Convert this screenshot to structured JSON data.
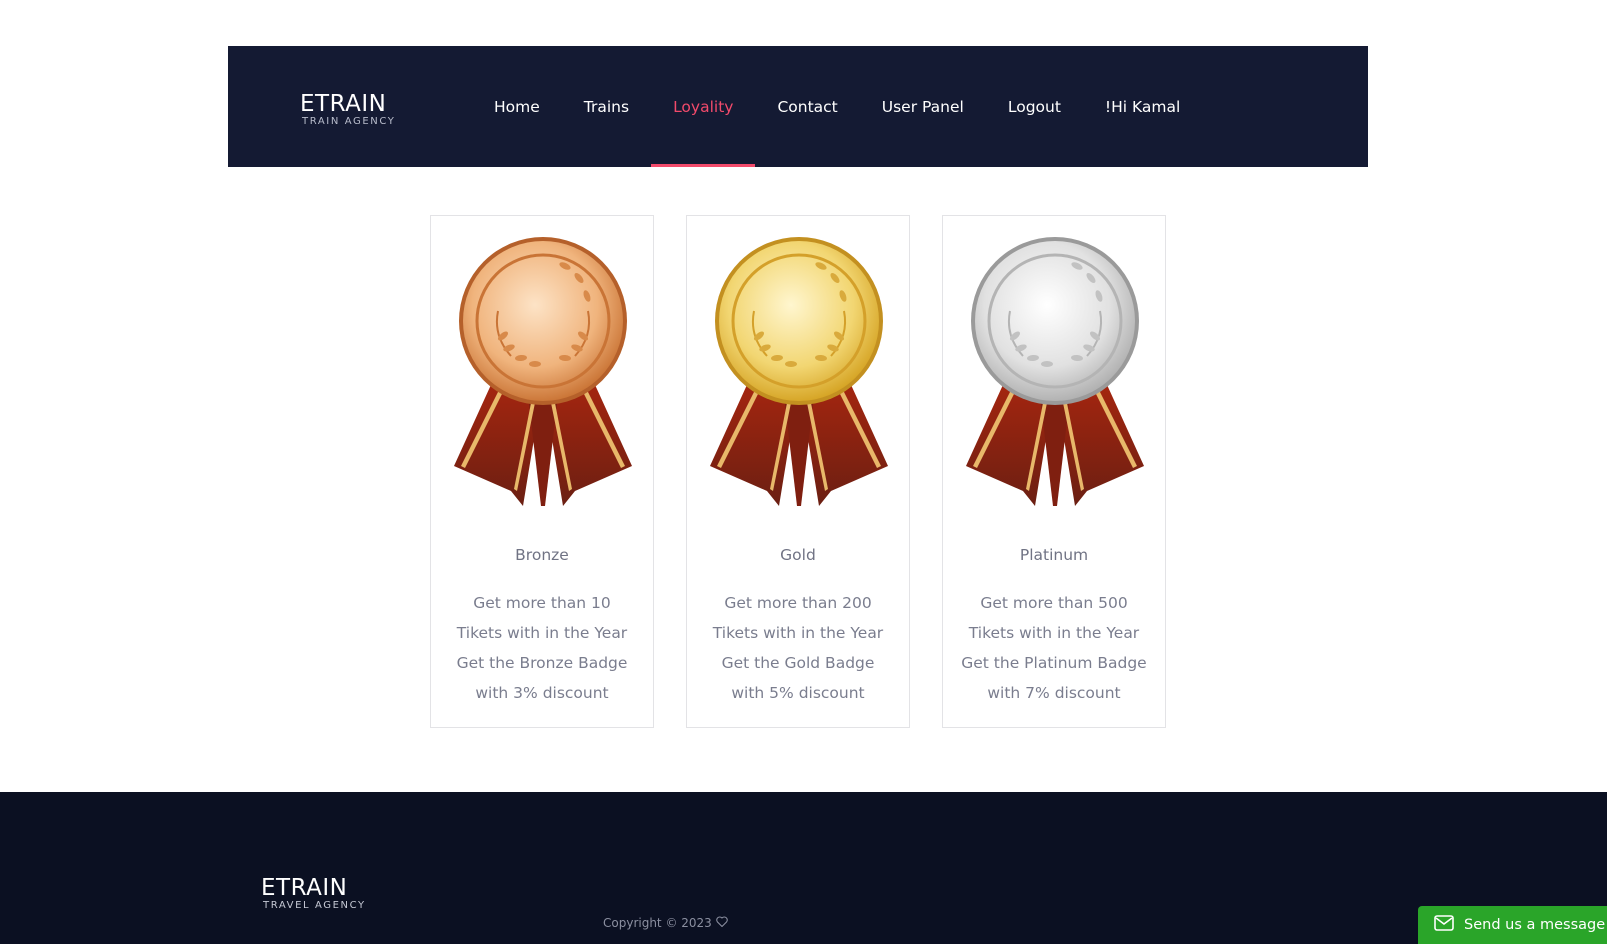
{
  "header": {
    "logo_main": "ETRAIN",
    "logo_sub": "TRAIN AGENCY",
    "nav": [
      {
        "label": "Home",
        "active": false
      },
      {
        "label": "Trains",
        "active": false
      },
      {
        "label": "Loyality",
        "active": true
      },
      {
        "label": "Contact",
        "active": false
      },
      {
        "label": "User Panel",
        "active": false
      },
      {
        "label": "Logout",
        "active": false
      },
      {
        "label": "!Hi Kamal",
        "active": false
      }
    ]
  },
  "tiers": [
    {
      "title": "Bronze",
      "description": "Get more than 10 Tikets with in the Year Get the Bronze Badge with 3% discount",
      "medal": "bronze-medal-icon"
    },
    {
      "title": "Gold",
      "description": "Get more than 200 Tikets with in the Year Get the Gold Badge with 5% discount",
      "medal": "gold-medal-icon"
    },
    {
      "title": "Platinum",
      "description": "Get more than 500 Tikets with in the Year Get the Platinum Badge with 7% discount",
      "medal": "platinum-medal-icon"
    }
  ],
  "footer": {
    "logo_main": "ETRAIN",
    "logo_sub": "TRAVEL AGENCY",
    "copyright": "Copyright © 2023",
    "heart_icon": "heart-icon"
  },
  "chat": {
    "label": "Send us a message",
    "icon": "mail-icon"
  },
  "colors": {
    "header_bg": "#141a33",
    "footer_bg": "#0b1022",
    "accent": "#f24a6b",
    "chat_green": "#2aa529"
  }
}
